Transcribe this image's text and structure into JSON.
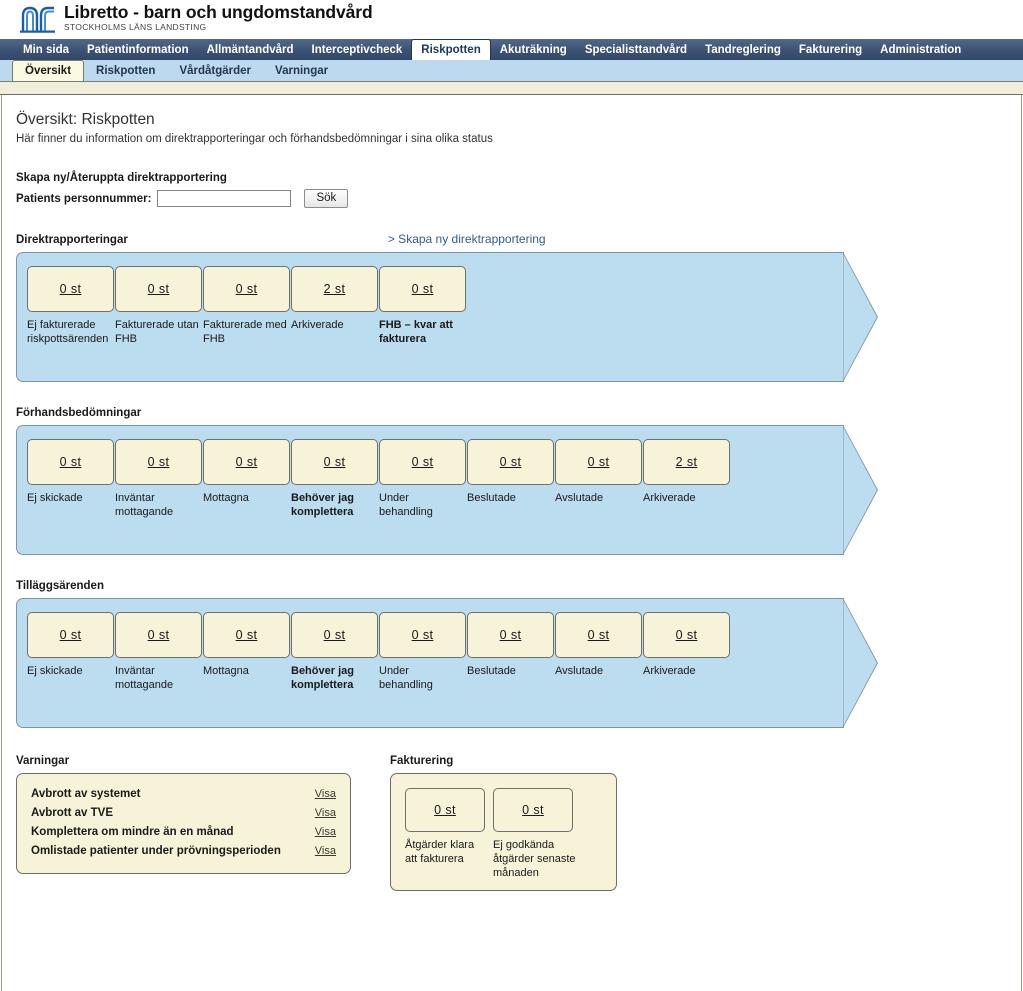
{
  "header": {
    "logo_icon": "sll-arch-logo",
    "title": "Libretto - barn och ungdomstandvård",
    "subtitle": "STOCKHOLMS LÄNS LANDSTING"
  },
  "mainnav": {
    "items": [
      {
        "label": "Min sida",
        "active": false
      },
      {
        "label": "Patientinformation",
        "active": false
      },
      {
        "label": "Allmäntandvård",
        "active": false
      },
      {
        "label": "Interceptivcheck",
        "active": false
      },
      {
        "label": "Riskpotten",
        "active": true
      },
      {
        "label": "Akuträkning",
        "active": false
      },
      {
        "label": "Specialisttandvård",
        "active": false
      },
      {
        "label": "Tandreglering",
        "active": false
      },
      {
        "label": "Fakturering",
        "active": false
      },
      {
        "label": "Administration",
        "active": false
      }
    ]
  },
  "subnav": {
    "items": [
      {
        "label": "Översikt",
        "active": true
      },
      {
        "label": "Riskpotten",
        "active": false
      },
      {
        "label": "Vårdåtgärder",
        "active": false
      },
      {
        "label": "Varningar",
        "active": false
      }
    ]
  },
  "page": {
    "title": "Översikt: Riskpotten",
    "subtitle": "Här finner du information om direktrapporteringar och förhandsbedömningar i sina olika status"
  },
  "search_form": {
    "heading": "Skapa ny/Återuppta direktrapportering",
    "field_label": "Patients personnummer:",
    "field_value": "",
    "field_placeholder": "",
    "button_label": "Sök"
  },
  "sections": [
    {
      "title": "Direktrapporteringar",
      "create_link": "> Skapa ny direktrapportering",
      "items": [
        {
          "count": "0 st",
          "label": "Ej fakturerade riskpottsärenden",
          "bold": false
        },
        {
          "count": "0 st",
          "label": "Fakturerade utan FHB",
          "bold": false
        },
        {
          "count": "0 st",
          "label": "Fakturerade med FHB",
          "bold": false
        },
        {
          "count": "2 st",
          "label": "Arkiverade",
          "bold": false
        },
        {
          "count": "0 st",
          "label": "FHB – kvar att fakturera",
          "bold": true
        }
      ]
    },
    {
      "title": "Förhandsbedömningar",
      "create_link": "",
      "items": [
        {
          "count": "0 st",
          "label": "Ej skickade",
          "bold": false
        },
        {
          "count": "0 st",
          "label": "Inväntar mottagande",
          "bold": false
        },
        {
          "count": "0 st",
          "label": "Mottagna",
          "bold": false
        },
        {
          "count": "0 st",
          "label": "Behöver jag komplettera",
          "bold": true
        },
        {
          "count": "0 st",
          "label": "Under behandling",
          "bold": false
        },
        {
          "count": "0 st",
          "label": "Beslutade",
          "bold": false
        },
        {
          "count": "0 st",
          "label": "Avslutade",
          "bold": false
        },
        {
          "count": "2 st",
          "label": "Arkiverade",
          "bold": false
        }
      ]
    },
    {
      "title": "Tilläggsärenden",
      "create_link": "",
      "items": [
        {
          "count": "0 st",
          "label": "Ej skickade",
          "bold": false
        },
        {
          "count": "0 st",
          "label": "Inväntar mottagande",
          "bold": false
        },
        {
          "count": "0 st",
          "label": "Mottagna",
          "bold": false
        },
        {
          "count": "0 st",
          "label": "Behöver jag komplettera",
          "bold": true
        },
        {
          "count": "0 st",
          "label": "Under behandling",
          "bold": false
        },
        {
          "count": "0 st",
          "label": "Beslutade",
          "bold": false
        },
        {
          "count": "0 st",
          "label": "Avslutade",
          "bold": false
        },
        {
          "count": "0 st",
          "label": "Arkiverade",
          "bold": false
        }
      ]
    }
  ],
  "warnings": {
    "title": "Varningar",
    "rows": [
      {
        "text": "Avbrott av systemet",
        "link": "Visa"
      },
      {
        "text": "Avbrott av TVE",
        "link": "Visa"
      },
      {
        "text": "Komplettera om mindre än en månad",
        "link": "Visa"
      },
      {
        "text": "Omlistade patienter under prövningsperioden",
        "link": "Visa"
      }
    ]
  },
  "invoicing": {
    "title": "Fakturering",
    "items": [
      {
        "count": "0 st",
        "label": "Åtgärder klara att fakturera"
      },
      {
        "count": "0 st",
        "label": "Ej godkända åtgärder senaste månaden"
      }
    ]
  },
  "colors": {
    "nav_bg": "#3b5272",
    "subnav_bg": "#bcd9ef",
    "arrow_fill": "#bcdcf0",
    "box_fill": "#f6f3d9",
    "link": "#2f5d8c"
  }
}
